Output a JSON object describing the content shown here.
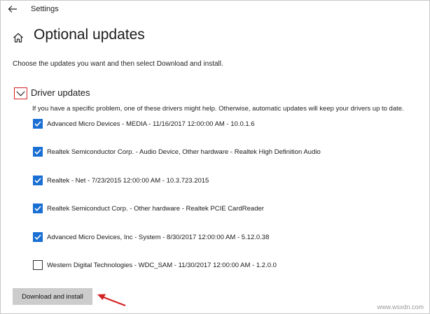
{
  "window": {
    "title": "Settings",
    "back_icon": "back-arrow-icon"
  },
  "header": {
    "home_icon": "home-icon",
    "title": "Optional updates"
  },
  "intro_text": "Choose the updates you want and then select Download and install.",
  "section": {
    "title": "Driver updates",
    "expanded": true,
    "toggle_icon": "chevron-down-icon",
    "description": "If you have a specific problem, one of these drivers might help. Otherwise, automatic updates will keep your drivers up to date.",
    "items": [
      {
        "label": "Advanced Micro Devices - MEDIA - 11/16/2017 12:00:00 AM - 10.0.1.6",
        "checked": true
      },
      {
        "label": "Realtek Semiconductor Corp. - Audio Device, Other hardware - Realtek High Definition Audio",
        "checked": true
      },
      {
        "label": "Realtek - Net - 7/23/2015 12:00:00 AM - 10.3.723.2015",
        "checked": true
      },
      {
        "label": "Realtek Semiconduct Corp. - Other hardware - Realtek PCIE CardReader",
        "checked": true
      },
      {
        "label": "Advanced Micro Devices, Inc - System - 8/30/2017 12:00:00 AM - 5.12.0.38",
        "checked": true
      },
      {
        "label": "Western Digital Technologies - WDC_SAM - 11/30/2017 12:00:00 AM - 1.2.0.0",
        "checked": false
      }
    ]
  },
  "actions": {
    "download_label": "Download and install"
  },
  "annotation": {
    "arrow_color": "#d42222"
  },
  "colors": {
    "checkbox_checked": "#1a6fd3",
    "button_bg": "#cccccc",
    "toggle_border": "#d42222"
  },
  "watermark": "www.wsxdn.com"
}
